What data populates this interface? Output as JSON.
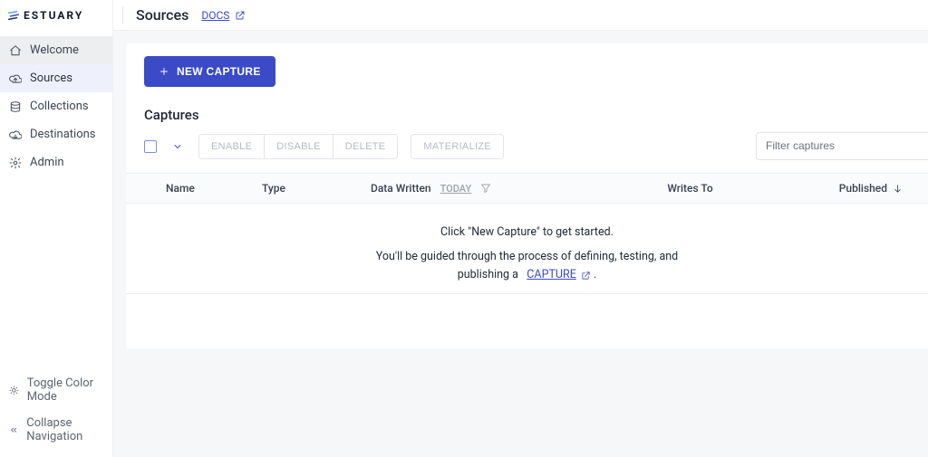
{
  "brand": "ESTUARY",
  "header": {
    "title": "Sources",
    "docs_label": "DOCS"
  },
  "sidebar": {
    "items": [
      {
        "label": "Welcome"
      },
      {
        "label": "Sources"
      },
      {
        "label": "Collections"
      },
      {
        "label": "Destinations"
      },
      {
        "label": "Admin"
      }
    ],
    "bottom": [
      {
        "label": "Toggle Color Mode"
      },
      {
        "label": "Collapse Navigation"
      }
    ]
  },
  "actions": {
    "new_capture": "NEW CAPTURE"
  },
  "section": {
    "title": "Captures"
  },
  "toolbar": {
    "enable": "ENABLE",
    "disable": "DISABLE",
    "delete": "DELETE",
    "materialize": "MATERIALIZE",
    "filter_placeholder": "Filter captures"
  },
  "columns": {
    "name": "Name",
    "type": "Type",
    "data_written": "Data Written",
    "data_written_period": "TODAY",
    "writes_to": "Writes To",
    "published": "Published"
  },
  "empty": {
    "line1": "Click \"New Capture\" to get started.",
    "line2a": "You'll be guided through the process of defining, testing, and",
    "line2b": "publishing a",
    "capture_link": "CAPTURE",
    "period": "."
  }
}
